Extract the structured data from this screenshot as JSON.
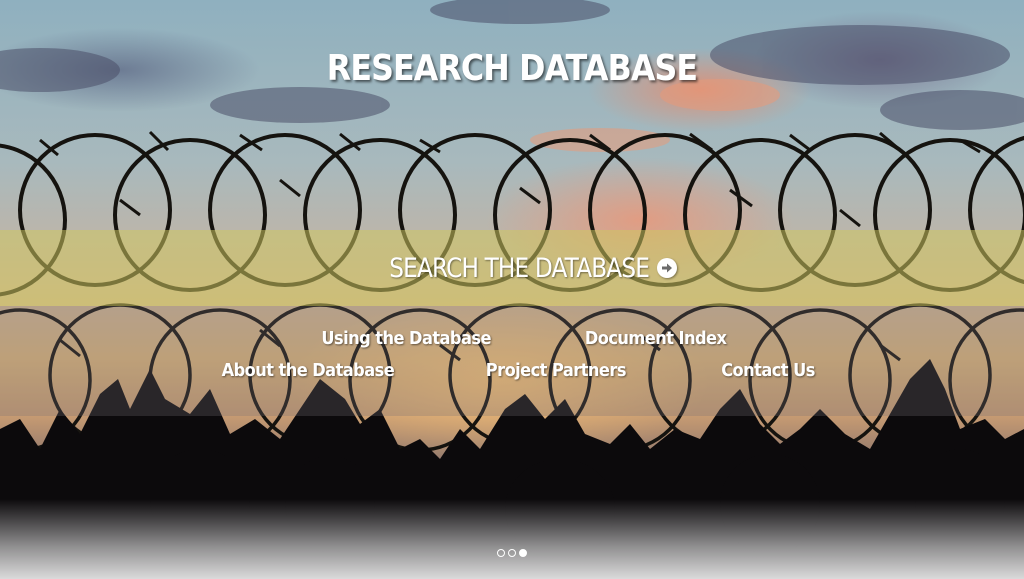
{
  "header": {
    "title": "RESEARCH DATABASE"
  },
  "search": {
    "label": "SEARCH THE DATABASE",
    "icon": "arrow-right-circle-icon"
  },
  "nav": {
    "row1": [
      {
        "label": "Using the Database"
      },
      {
        "label": "Document Index"
      }
    ],
    "row2": [
      {
        "label": "About the Database"
      },
      {
        "label": "Project Partners"
      },
      {
        "label": "Contact Us"
      }
    ]
  },
  "slider": {
    "count": 3,
    "active_index": 2
  },
  "colors": {
    "band_yellow": "#cdc660",
    "text": "#ffffff"
  }
}
